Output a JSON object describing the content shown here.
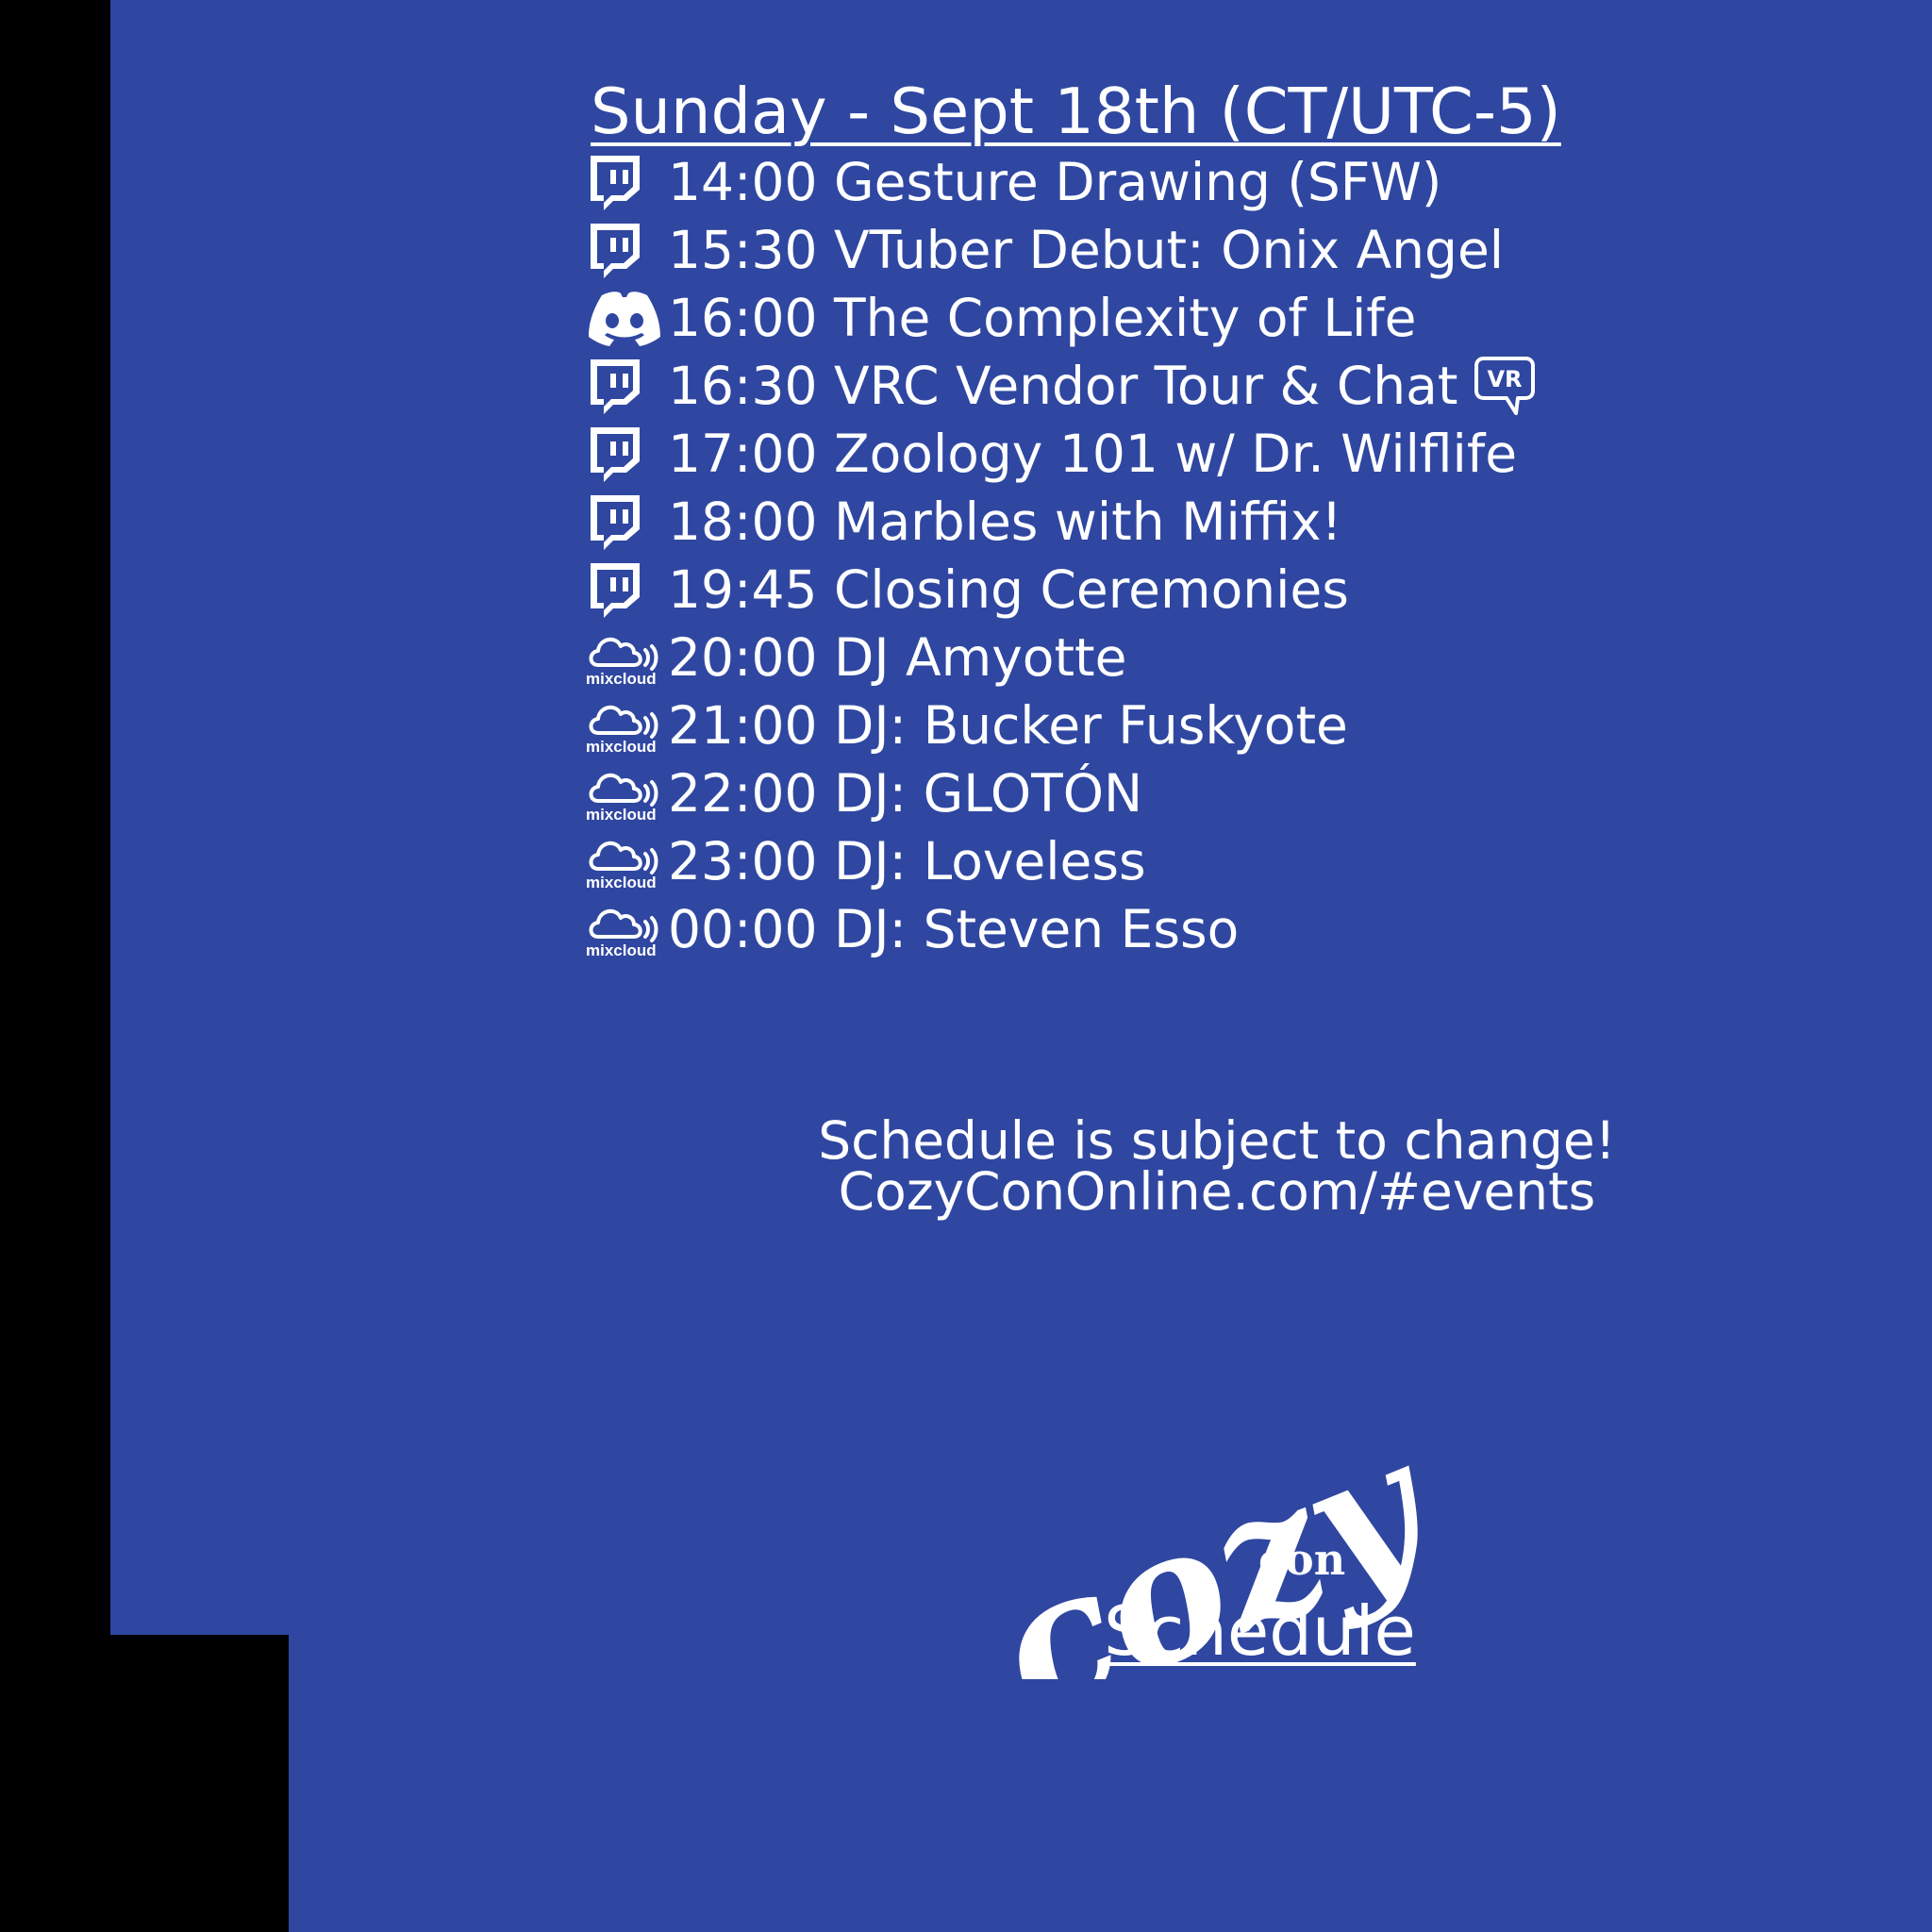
{
  "title": "Sunday - Sept 18th (CT/UTC-5)",
  "events": [
    {
      "platform_icon": "twitch-icon",
      "text": "14:00 Gesture Drawing (SFW)"
    },
    {
      "platform_icon": "twitch-icon",
      "text": "15:30 VTuber Debut: Onix Angel"
    },
    {
      "platform_icon": "discord-icon",
      "text": "16:00 The Complexity of Life"
    },
    {
      "platform_icon": "twitch-icon",
      "text": "16:30 VRC Vendor Tour & Chat",
      "extra_icon": "vr-chat-icon",
      "extra_label": "VR"
    },
    {
      "platform_icon": "twitch-icon",
      "text": "17:00 Zoology 101 w/ Dr. Wilflife"
    },
    {
      "platform_icon": "twitch-icon",
      "text": "18:00 Marbles with Miffix!"
    },
    {
      "platform_icon": "twitch-icon",
      "text": "19:45 Closing Ceremonies"
    },
    {
      "platform_icon": "mixcloud-icon",
      "text": "20:00 DJ Amyotte"
    },
    {
      "platform_icon": "mixcloud-icon",
      "text": "21:00 DJ: Bucker Fuskyote"
    },
    {
      "platform_icon": "mixcloud-icon",
      "text": "22:00 DJ: GLOTÓN"
    },
    {
      "platform_icon": "mixcloud-icon",
      "text": "23:00 DJ: Loveless"
    },
    {
      "platform_icon": "mixcloud-icon",
      "text": "00:00 DJ: Steven Esso"
    }
  ],
  "mixcloud_label": "mixcloud",
  "notice": {
    "line1": "Schedule is subject to change!",
    "line2": "CozyConOnline.com/#events"
  },
  "logo": {
    "cozy": "cozy",
    "con": "con",
    "schedule": "Schedule"
  },
  "colors": {
    "background": "#2f47a1",
    "outer": "#000000",
    "text": "#ffffff"
  }
}
